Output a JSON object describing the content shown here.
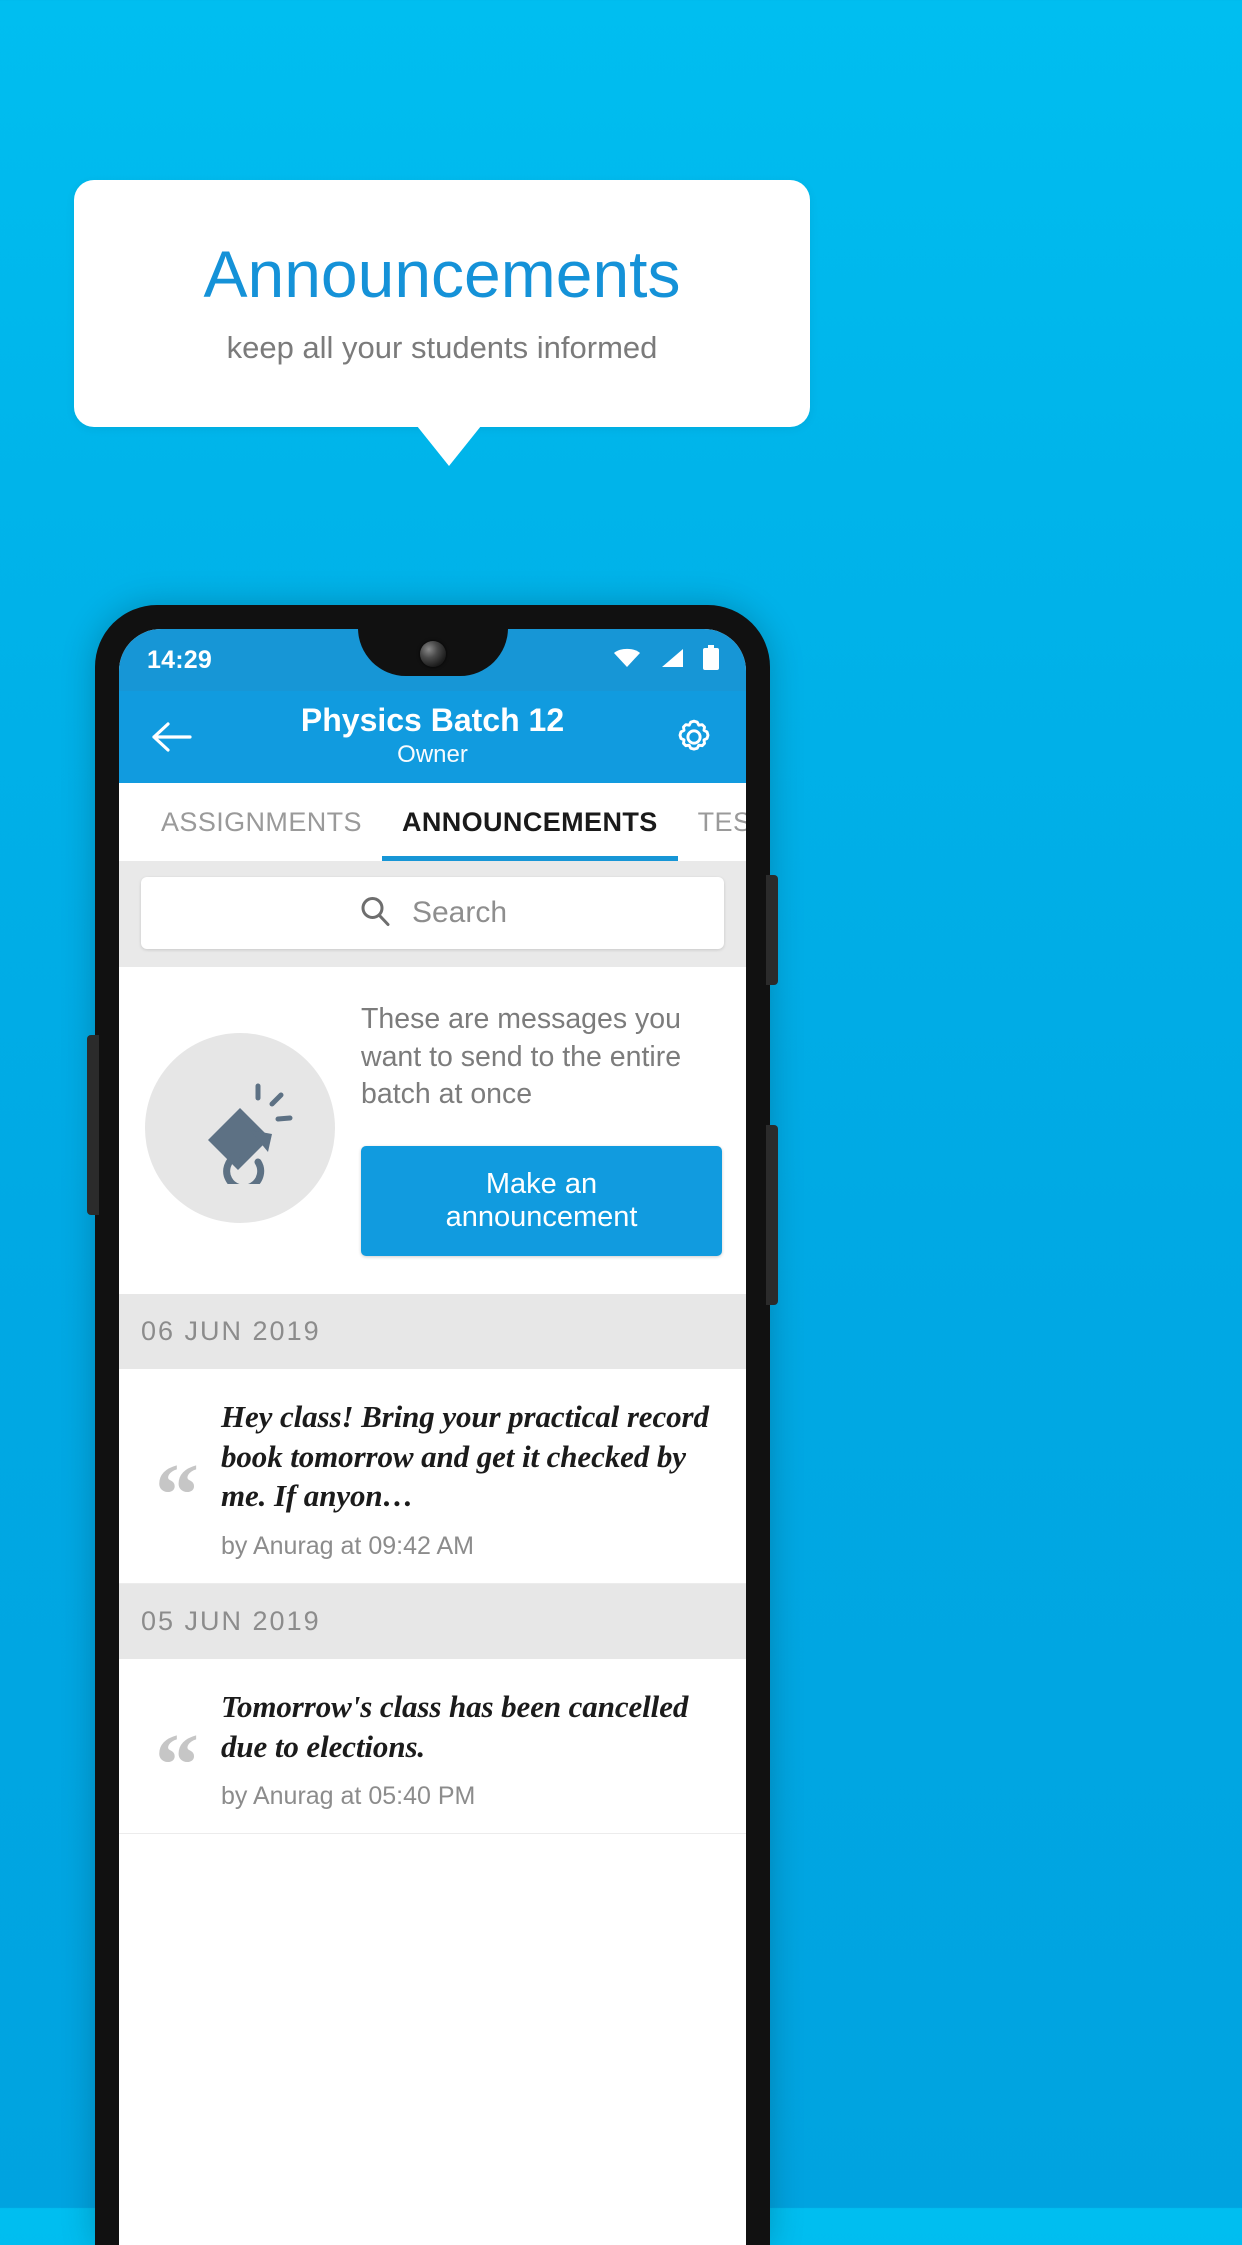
{
  "promo_card": {
    "title": "Announcements",
    "subtitle": "keep all your students informed"
  },
  "colors": {
    "background_top": "#00BEF0",
    "background_bottom": "#00A3E0",
    "brand_blue": "#119BDF",
    "title_blue": "#1592D8",
    "statusbar_blue": "#1796D6",
    "gray_bg": "#E7E7E7",
    "muted_text": "#8C8C8C"
  },
  "phone": {
    "statusbar": {
      "time": "14:29",
      "icons": [
        "wifi-icon",
        "signal-icon",
        "battery-icon"
      ]
    },
    "appbar": {
      "back_icon": "back-arrow-icon",
      "title": "Physics Batch 12",
      "subtitle": "Owner",
      "settings_icon": "gear-icon"
    },
    "tabs": [
      {
        "label": "ASSIGNMENTS",
        "active": false
      },
      {
        "label": "ANNOUNCEMENTS",
        "active": true
      },
      {
        "label": "TESTS",
        "active": false
      },
      {
        "label": "’",
        "active": false
      }
    ],
    "search": {
      "icon": "search-icon",
      "placeholder": "Search",
      "value": ""
    },
    "promo": {
      "icon": "megaphone-icon",
      "description": "These are messages you want to send to the entire batch at once",
      "button_label": "Make an announcement"
    },
    "groups": [
      {
        "date": "06  JUN  2019",
        "items": [
          {
            "quote_icon": "quote-icon",
            "text": "Hey class! Bring your practical record book tomorrow and get it checked by me. If anyon…",
            "meta": "by Anurag at 09:42 AM"
          }
        ]
      },
      {
        "date": "05  JUN  2019",
        "items": [
          {
            "quote_icon": "quote-icon",
            "text": "Tomorrow's class has been cancelled due to elections.",
            "meta": "by Anurag at 05:40 PM"
          }
        ]
      }
    ]
  }
}
